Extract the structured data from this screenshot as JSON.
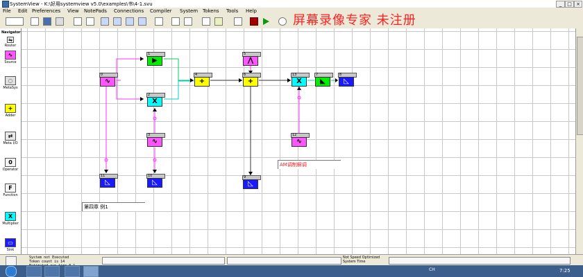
{
  "window": {
    "title": "SystemView - K:\\好用systemview  v5.0\\examples\\书\\4-1.svu",
    "min_label": "_",
    "max_label": "□",
    "close_label": "×"
  },
  "menu": [
    "File",
    "Edit",
    "Preferences",
    "View",
    "NotePads",
    "Connections",
    "Compiler",
    "System",
    "Tokens",
    "Tools",
    "Help"
  ],
  "watermark": "屏幕录像专家  未注册",
  "navigator": {
    "title": "Navigator",
    "items": [
      {
        "label": "Router",
        "glyph": "⇋"
      },
      {
        "label": "Source",
        "glyph": "∿"
      },
      {
        "label": "MetaSys",
        "glyph": "◌"
      },
      {
        "label": "Adder",
        "glyph": "+"
      },
      {
        "label": "Meta I/O",
        "glyph": "⇄"
      },
      {
        "label": "Operator",
        "glyph": "0"
      },
      {
        "label": "Function",
        "glyph": "F"
      },
      {
        "label": "Multiplier",
        "glyph": "X"
      },
      {
        "label": "Sink",
        "glyph": "▭"
      }
    ]
  },
  "tokens": [
    {
      "id": "0",
      "kind": "src",
      "symbol": "∿"
    },
    {
      "id": "1",
      "kind": "filt",
      "symbol": "▶"
    },
    {
      "id": "2",
      "kind": "mul",
      "symbol": "X"
    },
    {
      "id": "3",
      "kind": "src",
      "symbol": "∿"
    },
    {
      "id": "4",
      "kind": "add",
      "symbol": "+"
    },
    {
      "id": "5",
      "kind": "src",
      "symbol": "⋀"
    },
    {
      "id": "6",
      "kind": "add",
      "symbol": "+"
    },
    {
      "id": "7",
      "kind": "filt",
      "symbol": "◣"
    },
    {
      "id": "8",
      "kind": "sink",
      "symbol": "◺"
    },
    {
      "id": "9",
      "kind": "sink",
      "symbol": "◺"
    },
    {
      "id": "10",
      "kind": "sink",
      "symbol": "◺"
    },
    {
      "id": "11",
      "kind": "sink",
      "symbol": "◺"
    },
    {
      "id": "12",
      "kind": "src",
      "symbol": "∿"
    },
    {
      "id": "13",
      "kind": "mul",
      "symbol": "X"
    }
  ],
  "notes": {
    "note1": "AM调制解调",
    "note2": "第四章  例1"
  },
  "status": {
    "log1": "System not Executed",
    "log2": "Token count is 14",
    "log3": "Estimated run time 0.1",
    "opt": "Not Speed Optimized",
    "systime": "System Time"
  },
  "taskbar": {
    "tray_text": "CH",
    "clock": "7:25"
  }
}
